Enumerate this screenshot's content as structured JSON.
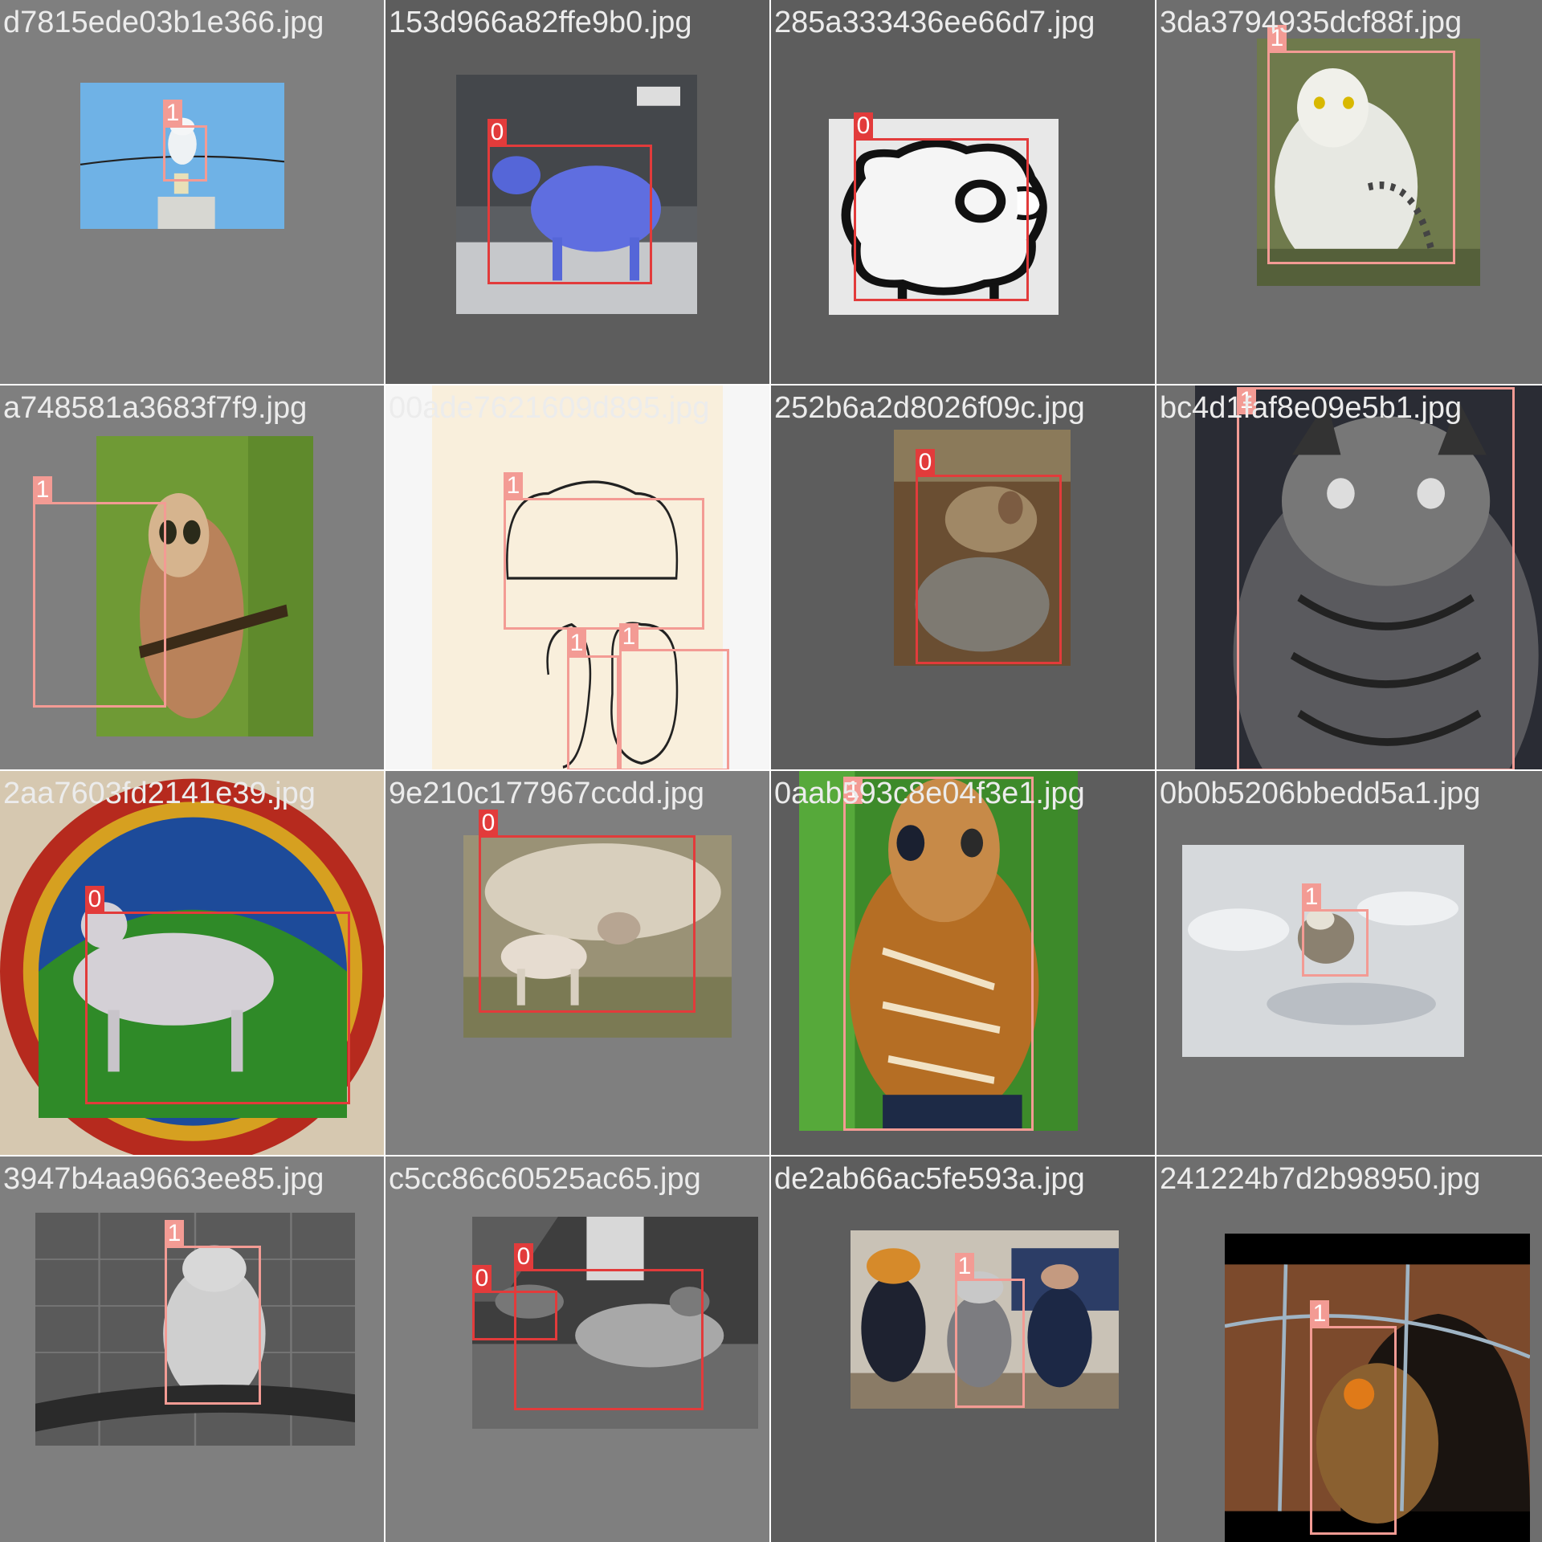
{
  "colors": {
    "tile_light": "#7f7f7f",
    "tile_dark": "#5d5d5d",
    "tile_mid": "#6e6e6e",
    "name_text": "#ececec",
    "class_0_box": "#e23b3b",
    "class_1_box": "#f39b94"
  },
  "tiles": [
    {
      "file_name": "d7815ede03b1e366.jpg",
      "subject": "snowy-owl-on-wire",
      "detections": [
        {
          "class_label": "1"
        }
      ]
    },
    {
      "file_name": "153d966a82ffe9b0.jpg",
      "subject": "blue-sheep-statue",
      "detections": [
        {
          "class_label": "0"
        }
      ]
    },
    {
      "file_name": "285a333436ee66d7.jpg",
      "subject": "sheep-drawing",
      "detections": [
        {
          "class_label": "0"
        }
      ]
    },
    {
      "file_name": "3da3794935dcf88f.jpg",
      "subject": "snowy-owl-grass",
      "detections": [
        {
          "class_label": "1"
        }
      ]
    },
    {
      "file_name": "a748581a3683f7f9.jpg",
      "subject": "saw-whet-owl",
      "detections": [
        {
          "class_label": "1"
        }
      ]
    },
    {
      "file_name": "00ade7621609d895.jpg",
      "subject": "owl-sketches",
      "detections": [
        {
          "class_label": "1"
        },
        {
          "class_label": "1"
        },
        {
          "class_label": "1"
        }
      ]
    },
    {
      "file_name": "252b6a2d8026f09c.jpg",
      "subject": "sheep-shearing",
      "detections": [
        {
          "class_label": "0"
        }
      ]
    },
    {
      "file_name": "bc4d1faf8e09e5b1.jpg",
      "subject": "great-horned-owl",
      "detections": [
        {
          "class_label": "1"
        }
      ]
    },
    {
      "file_name": "2aa7603fd2141e39.jpg",
      "subject": "medieval-sheep-roundel",
      "detections": [
        {
          "class_label": "0"
        }
      ]
    },
    {
      "file_name": "9e210c177967ccdd.jpg",
      "subject": "ewe-and-lamb",
      "detections": [
        {
          "class_label": "0"
        }
      ]
    },
    {
      "file_name": "0aab593c8e04f3e1.jpg",
      "subject": "tawny-owl",
      "detections": [
        {
          "class_label": "1"
        }
      ]
    },
    {
      "file_name": "0b0b5206bbedd5a1.jpg",
      "subject": "owl-on-ice",
      "detections": [
        {
          "class_label": "1"
        }
      ]
    },
    {
      "file_name": "3947b4aa9663ee85.jpg",
      "subject": "snowy-owl-grayscale",
      "detections": [
        {
          "class_label": "1"
        }
      ]
    },
    {
      "file_name": "c5cc86c60525ac65.jpg",
      "subject": "sheep-in-barn",
      "detections": [
        {
          "class_label": "0"
        },
        {
          "class_label": "0"
        }
      ]
    },
    {
      "file_name": "de2ab66ac5fe593a.jpg",
      "subject": "mascots-indoors",
      "detections": [
        {
          "class_label": "1"
        }
      ]
    },
    {
      "file_name": "241224b7d2b98950.jpg",
      "subject": "eagle-owl-in-cage",
      "detections": [
        {
          "class_label": "1"
        }
      ]
    }
  ]
}
